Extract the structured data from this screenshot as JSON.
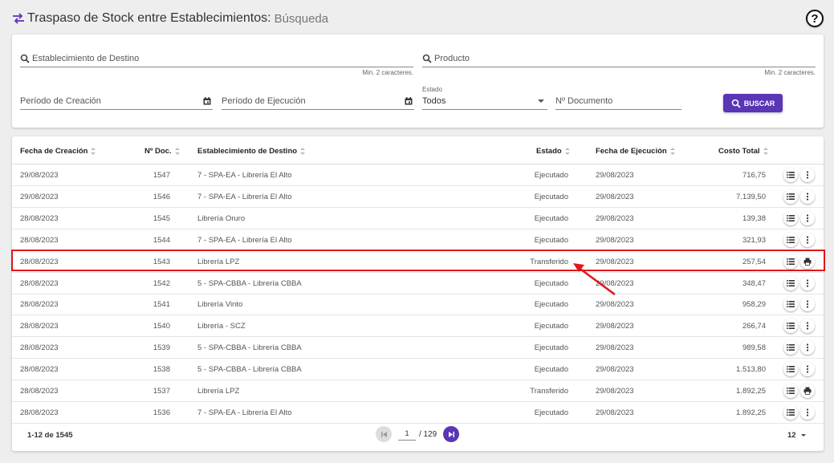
{
  "header": {
    "title": "Traspaso de Stock entre Establecimientos:",
    "subtitle": "Búsqueda",
    "help_label": "?"
  },
  "search": {
    "destino_placeholder": "Establecimiento de Destino",
    "destino_hint": "Min. 2 caracteres.",
    "producto_placeholder": "Producto",
    "producto_hint": "Min. 2 caracteres.",
    "creacion_placeholder": "Período de Creación",
    "ejecucion_placeholder": "Período de Ejecución",
    "estado_label": "Estado",
    "estado_value": "Todos",
    "documento_placeholder": "Nº Documento",
    "buscar_label": "BUSCAR"
  },
  "table": {
    "columns": [
      "Fecha de Creación",
      "Nº Doc.",
      "Establecimiento de Destino",
      "Estado",
      "Fecha de Ejecución",
      "Costo Total"
    ],
    "rows": [
      {
        "creacion": "29/08/2023",
        "doc": "1547",
        "destino": "7 - SPA-EA - Librería El Alto",
        "estado": "Ejecutado",
        "ejecucion": "29/08/2023",
        "costo": "716,75",
        "action2": "more"
      },
      {
        "creacion": "29/08/2023",
        "doc": "1546",
        "destino": "7 - SPA-EA - Librería El Alto",
        "estado": "Ejecutado",
        "ejecucion": "29/08/2023",
        "costo": "7.139,50",
        "action2": "more"
      },
      {
        "creacion": "28/08/2023",
        "doc": "1545",
        "destino": "Librería Oruro",
        "estado": "Ejecutado",
        "ejecucion": "29/08/2023",
        "costo": "139,38",
        "action2": "more"
      },
      {
        "creacion": "28/08/2023",
        "doc": "1544",
        "destino": "7 - SPA-EA - Librería El Alto",
        "estado": "Ejecutado",
        "ejecucion": "29/08/2023",
        "costo": "321,93",
        "action2": "more"
      },
      {
        "creacion": "28/08/2023",
        "doc": "1543",
        "destino": "Librería LPZ",
        "estado": "Transferido",
        "ejecucion": "29/08/2023",
        "costo": "257,54",
        "action2": "print"
      },
      {
        "creacion": "28/08/2023",
        "doc": "1542",
        "destino": "5 - SPA-CBBA - Librería CBBA",
        "estado": "Ejecutado",
        "ejecucion": "29/08/2023",
        "costo": "348,47",
        "action2": "more"
      },
      {
        "creacion": "28/08/2023",
        "doc": "1541",
        "destino": "Librería Vinto",
        "estado": "Ejecutado",
        "ejecucion": "29/08/2023",
        "costo": "958,29",
        "action2": "more"
      },
      {
        "creacion": "28/08/2023",
        "doc": "1540",
        "destino": "Librería - SCZ",
        "estado": "Ejecutado",
        "ejecucion": "29/08/2023",
        "costo": "266,74",
        "action2": "more"
      },
      {
        "creacion": "28/08/2023",
        "doc": "1539",
        "destino": "5 - SPA-CBBA - Librería CBBA",
        "estado": "Ejecutado",
        "ejecucion": "29/08/2023",
        "costo": "989,58",
        "action2": "more"
      },
      {
        "creacion": "28/08/2023",
        "doc": "1538",
        "destino": "5 - SPA-CBBA - Librería CBBA",
        "estado": "Ejecutado",
        "ejecucion": "29/08/2023",
        "costo": "1.513,80",
        "action2": "more"
      },
      {
        "creacion": "28/08/2023",
        "doc": "1537",
        "destino": "Librería LPZ",
        "estado": "Transferido",
        "ejecucion": "29/08/2023",
        "costo": "1.892,25",
        "action2": "print"
      },
      {
        "creacion": "28/08/2023",
        "doc": "1536",
        "destino": "7 - SPA-EA - Librería El Alto",
        "estado": "Ejecutado",
        "ejecucion": "29/08/2023",
        "costo": "1.892,25",
        "action2": "more"
      }
    ]
  },
  "footer": {
    "range_label": "1-12 de 1545",
    "page_value": "1",
    "page_total": "/ 129",
    "per_page": "12"
  },
  "colors": {
    "accent": "#5a35b5",
    "annotation": "#e0161b"
  },
  "icons": {
    "title": "swap-arrows-icon",
    "search": "magnifier-icon",
    "date": "calendar-icon",
    "detail": "list-icon",
    "more": "more-vertical-icon",
    "print": "printer-icon"
  }
}
